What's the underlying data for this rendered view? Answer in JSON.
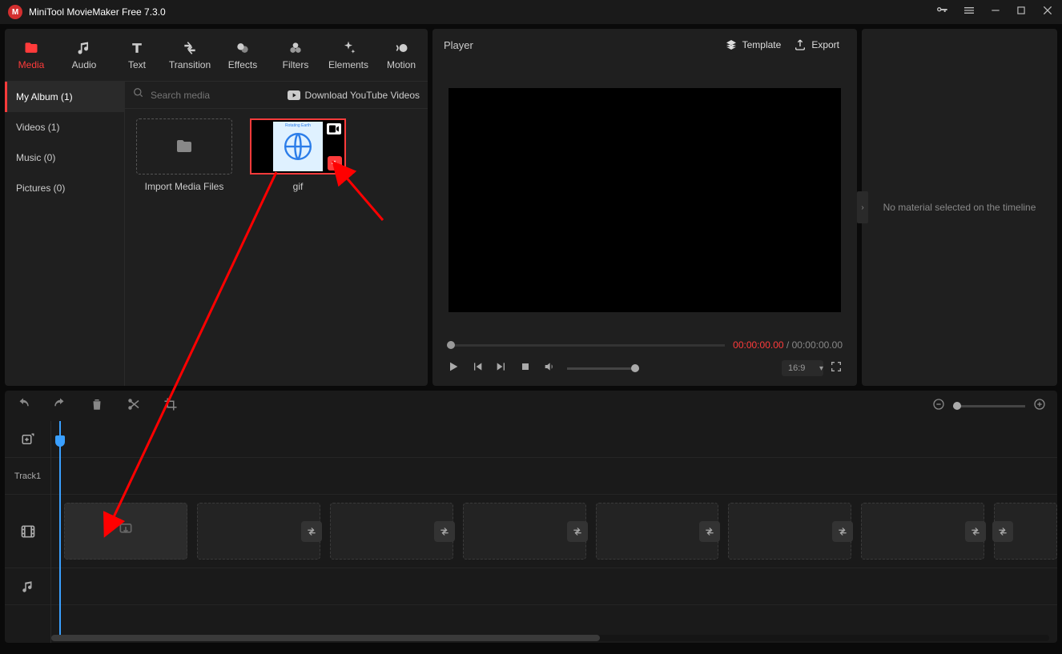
{
  "app": {
    "title": "MiniTool MovieMaker Free 7.3.0"
  },
  "tabs": {
    "media": "Media",
    "audio": "Audio",
    "text": "Text",
    "transition": "Transition",
    "effects": "Effects",
    "filters": "Filters",
    "elements": "Elements",
    "motion": "Motion"
  },
  "sidebar": {
    "my_album": "My Album (1)",
    "videos": "Videos (1)",
    "music": "Music (0)",
    "pictures": "Pictures (0)"
  },
  "search": {
    "placeholder": "Search media"
  },
  "download_link": "Download YouTube Videos",
  "media_items": {
    "import": "Import Media Files",
    "gif": "gif",
    "gif_thumb_text": "Rotating Earth"
  },
  "player": {
    "title": "Player",
    "template": "Template",
    "export": "Export",
    "time_current": "00:00:00.00",
    "time_sep": "/",
    "time_total": "00:00:00.00",
    "aspect": "16:9"
  },
  "right_panel": {
    "message": "No material selected on the timeline"
  },
  "timeline": {
    "track1": "Track1"
  }
}
